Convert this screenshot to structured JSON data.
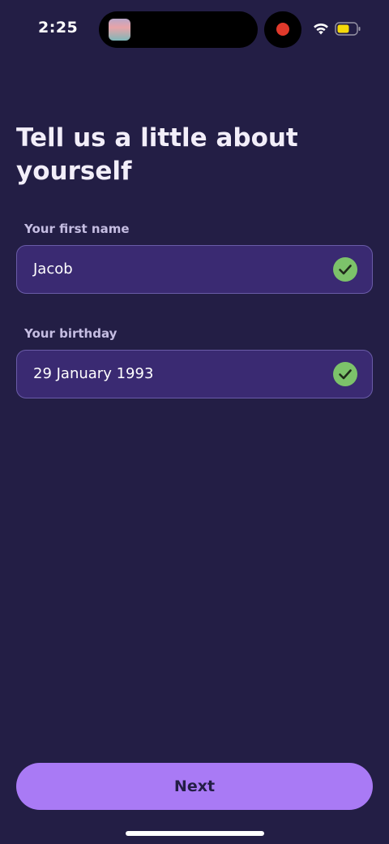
{
  "status_bar": {
    "time": "2:25"
  },
  "page": {
    "title": "Tell us a little about yourself"
  },
  "fields": {
    "first_name": {
      "label": "Your first name",
      "value": "Jacob"
    },
    "birthday": {
      "label": "Your birthday",
      "value": "29 January 1993"
    }
  },
  "actions": {
    "next_label": "Next"
  },
  "colors": {
    "background": "#231e45",
    "field_background": "#3a2a72",
    "field_border": "#6a5ca8",
    "accent": "#a97af5",
    "success": "#7cc26a",
    "label": "#c5bde2"
  },
  "icons": [
    "wifi-icon",
    "battery-icon",
    "check-icon",
    "record-icon"
  ]
}
